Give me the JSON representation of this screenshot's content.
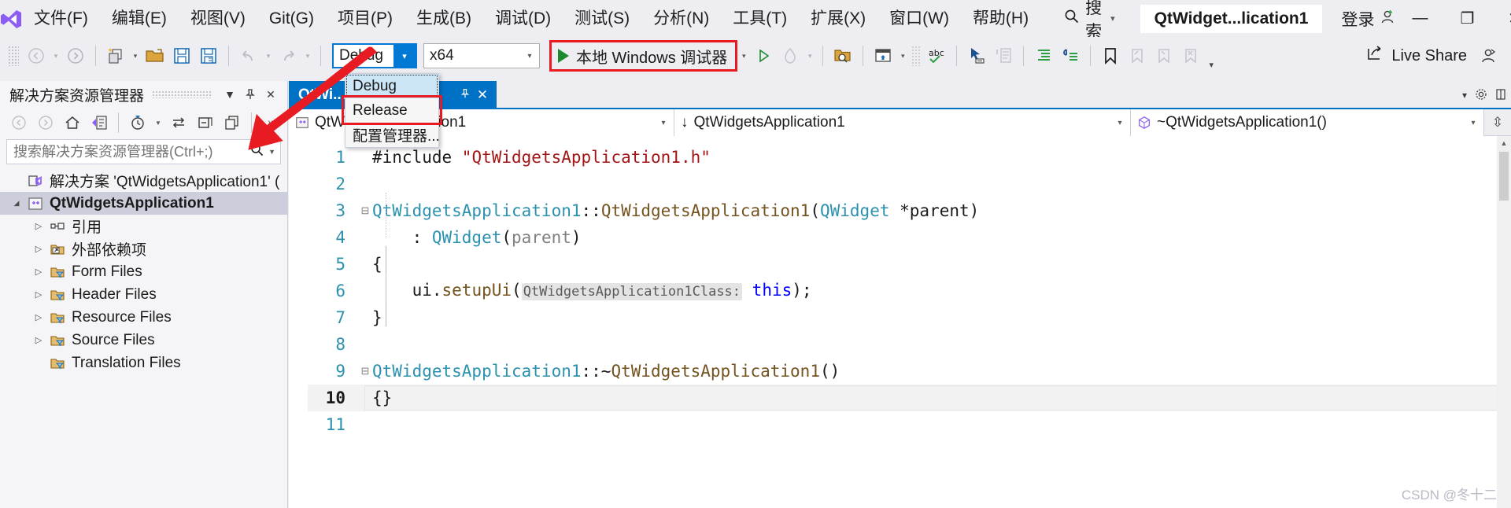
{
  "window": {
    "title": "QtWidget...lication1",
    "signin_label": "登录",
    "minimize": "—",
    "maximize": "❐",
    "close": "✕"
  },
  "menubar": {
    "logo": "visual-studio-logo",
    "items": [
      {
        "label": "文件(F)"
      },
      {
        "label": "编辑(E)"
      },
      {
        "label": "视图(V)"
      },
      {
        "label": "Git(G)"
      },
      {
        "label": "项目(P)"
      },
      {
        "label": "生成(B)"
      },
      {
        "label": "调试(D)"
      },
      {
        "label": "测试(S)"
      },
      {
        "label": "分析(N)"
      },
      {
        "label": "工具(T)"
      },
      {
        "label": "扩展(X)"
      },
      {
        "label": "窗口(W)"
      },
      {
        "label": "帮助(H)"
      }
    ],
    "search_label": "搜索",
    "search_caret": "▾"
  },
  "toolbar": {
    "back_caret": "▾",
    "new_caret": "▾",
    "undo_caret": "▾",
    "redo_caret": "▾",
    "configuration": {
      "value": "Debug",
      "arrow": "▾"
    },
    "platform": {
      "value": "x64",
      "arrow": "▾"
    },
    "run": {
      "label": "本地 Windows 调试器",
      "arrow": "▾"
    },
    "start_caret": "▾",
    "live_share": "Live Share",
    "overflow": "▾"
  },
  "config_dropdown": {
    "items": [
      {
        "label": "Debug",
        "state": "focused"
      },
      {
        "label": "Release",
        "state": "annotated"
      },
      {
        "label": "配置管理器...",
        "state": "normal"
      }
    ]
  },
  "solution_explorer": {
    "title": "解决方案资源管理器",
    "caret_icon": "▼",
    "pin_icon": "pin-icon",
    "close_icon": "✕",
    "toolbar_icons": [
      "back-icon",
      "forward-icon",
      "home-icon",
      "sync-with-active-document-icon",
      "pending-changes-icon",
      "pending-changes-caret",
      "switch-views-icon",
      "collapse-all-icon",
      "properties-icon",
      "overflow-icon"
    ],
    "search_placeholder": "搜索解决方案资源管理器(Ctrl+;)",
    "search_value": "",
    "tree": [
      {
        "label": "解决方案 'QtWidgetsApplication1' (",
        "level": 0,
        "twisty": "",
        "icon": "solution-icon",
        "bold": false,
        "selected": false
      },
      {
        "label": "QtWidgetsApplication1",
        "level": 1,
        "twisty": "◢",
        "icon": "cpp-project-icon",
        "bold": true,
        "selected": true
      },
      {
        "label": "引用",
        "level": 2,
        "twisty": "▷",
        "icon": "references-icon",
        "bold": false,
        "selected": false
      },
      {
        "label": "外部依赖项",
        "level": 2,
        "twisty": "▷",
        "icon": "external-deps-icon",
        "bold": false,
        "selected": false
      },
      {
        "label": "Form Files",
        "level": 2,
        "twisty": "▷",
        "icon": "filter-folder-icon",
        "bold": false,
        "selected": false
      },
      {
        "label": "Header Files",
        "level": 2,
        "twisty": "▷",
        "icon": "filter-folder-icon",
        "bold": false,
        "selected": false
      },
      {
        "label": "Resource Files",
        "level": 2,
        "twisty": "▷",
        "icon": "filter-folder-icon",
        "bold": false,
        "selected": false
      },
      {
        "label": "Source Files",
        "level": 2,
        "twisty": "▷",
        "icon": "filter-folder-icon",
        "bold": false,
        "selected": false
      },
      {
        "label": "Translation Files",
        "level": 2,
        "twisty": "",
        "icon": "filter-folder-icon",
        "bold": false,
        "selected": false
      }
    ]
  },
  "editor": {
    "tab": {
      "name": "QtWi...on1.cpp",
      "pin_icon": "⌁",
      "close_icon": "✕"
    },
    "tabstrip_right": {
      "caret": "▾",
      "settings_icon": "gear-icon",
      "split_icon": "split-icon"
    },
    "navbar": {
      "project": "QtWidgetsApplication1",
      "project_icon": "cpp-project-icon",
      "type": "QtWidgetsApplication1",
      "type_icon": "↓",
      "member": "~QtWidgetsApplication1()",
      "member_icon": "method-icon",
      "arrow": "▾",
      "split_icon": "⇳"
    },
    "lines": [
      {
        "n": "1",
        "fold": "",
        "current": false
      },
      {
        "n": "2",
        "fold": "",
        "current": false
      },
      {
        "n": "3",
        "fold": "⊟",
        "current": false
      },
      {
        "n": "4",
        "fold": "",
        "current": false
      },
      {
        "n": "5",
        "fold": "",
        "current": false
      },
      {
        "n": "6",
        "fold": "",
        "current": false
      },
      {
        "n": "7",
        "fold": "",
        "current": false
      },
      {
        "n": "8",
        "fold": "",
        "current": false
      },
      {
        "n": "9",
        "fold": "⊟",
        "current": false
      },
      {
        "n": "10",
        "fold": "",
        "current": true
      },
      {
        "n": "11",
        "fold": "",
        "current": false
      }
    ],
    "code": {
      "l1_include": "#include ",
      "l1_header": "\"QtWidgetsApplication1.h\"",
      "l3_cls": "QtWidgetsApplication1",
      "l3_colons": "::",
      "l3_ctor": "QtWidgetsApplication1",
      "l3_open": "(",
      "l3_qwidget": "QWidget",
      "l3_star": " *parent",
      "l3_close": ")",
      "l4_colon": "    : ",
      "l4_base": "QWidget",
      "l4_open": "(",
      "l4_parent": "parent",
      "l4_close": ")",
      "l5": "{",
      "l6_ui": "    ui.",
      "l6_fn": "setupUi",
      "l6_open": "(",
      "l6_hint": "QtWidgetsApplication1Class:",
      "l6_this": " this",
      "l6_close": ");",
      "l7": "}",
      "l9_cls": "QtWidgetsApplication1",
      "l9_colons": "::~",
      "l9_dtor": "QtWidgetsApplication1",
      "l9_parens": "()",
      "l10": "{}"
    }
  },
  "watermark": "CSDN @冬十二",
  "colors": {
    "accent_blue": "#0078D4",
    "tab_blue": "#0072C6",
    "annotation_red": "#E81B23",
    "run_green": "#1B8A2F",
    "string_red": "#A31515",
    "type_teal": "#2B91AF",
    "keyword_blue": "#0000FF",
    "function_brown": "#74531F",
    "chrome_bg": "#EEEEF2",
    "panel_bg": "#F5F5F7"
  }
}
